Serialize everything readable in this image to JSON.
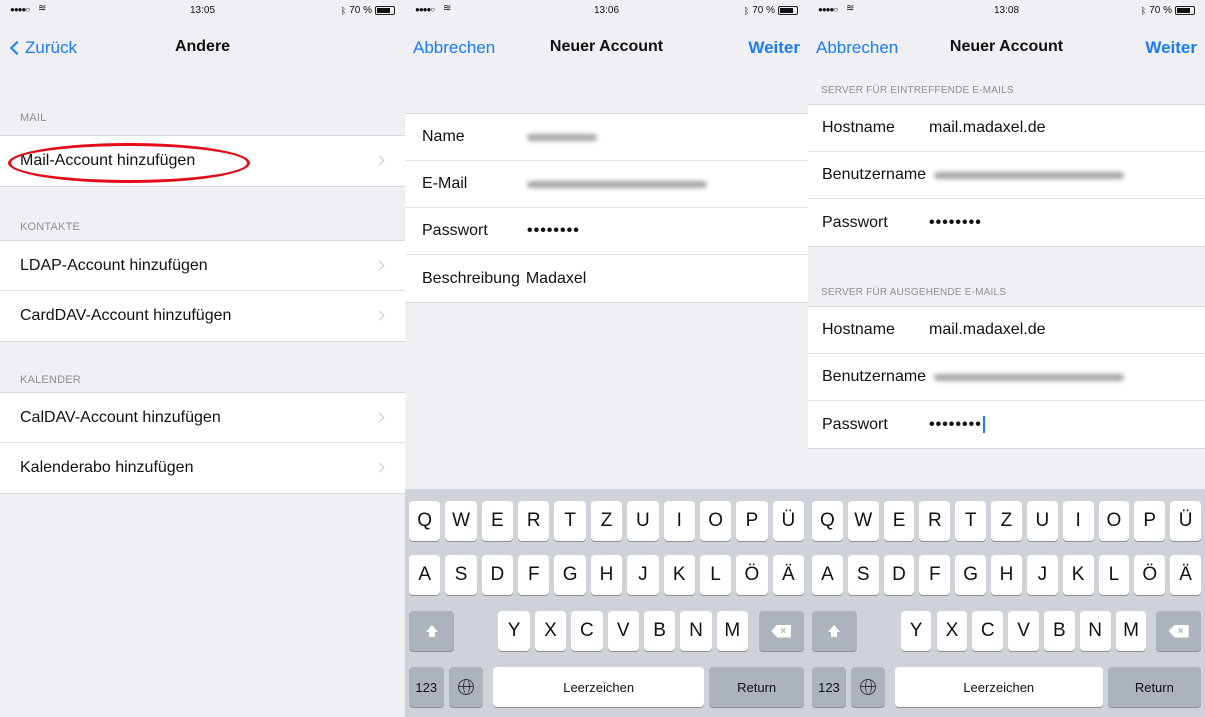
{
  "screen1": {
    "status": {
      "signal": "●●●●○",
      "time": "13:05",
      "battery": "70 %"
    },
    "nav": {
      "back": "Zurück",
      "title": "Andere"
    },
    "sections": [
      {
        "label": "MAIL",
        "items": [
          "Mail-Account hinzufügen"
        ]
      },
      {
        "label": "KONTAKTE",
        "items": [
          "LDAP-Account hinzufügen",
          "CardDAV-Account hinzufügen"
        ]
      },
      {
        "label": "KALENDER",
        "items": [
          "CalDAV-Account hinzufügen",
          "Kalenderabo hinzufügen"
        ]
      }
    ],
    "highlight_color": "#e30b17"
  },
  "screen2": {
    "status": {
      "signal": "●●●●○",
      "time": "13:06",
      "battery": "70 %"
    },
    "nav": {
      "cancel": "Abbrechen",
      "title": "Neuer Account",
      "next": "Weiter"
    },
    "fields": [
      {
        "label": "Name",
        "value": ""
      },
      {
        "label": "E-Mail",
        "value": ""
      },
      {
        "label": "Passwort",
        "value": "••••••••"
      },
      {
        "label": "Beschreibung",
        "value": "Madaxel"
      }
    ]
  },
  "screen3": {
    "status": {
      "signal": "●●●●○",
      "time": "13:08",
      "battery": "70 %"
    },
    "nav": {
      "cancel": "Abbrechen",
      "title": "Neuer Account",
      "next": "Weiter"
    },
    "incoming": {
      "label": "SERVER FÜR EINTREFFENDE E-MAILS",
      "hostname_label": "Hostname",
      "hostname": "mail.madaxel.de",
      "user_label": "Benutzername",
      "password_label": "Passwort",
      "password": "••••••••"
    },
    "outgoing": {
      "label": "SERVER FÜR AUSGEHENDE E-MAILS",
      "hostname_label": "Hostname",
      "hostname": "mail.madaxel.de",
      "user_label": "Benutzername",
      "password_label": "Passwort",
      "password": "••••••••"
    }
  },
  "keyboard": {
    "row1": [
      "Q",
      "W",
      "E",
      "R",
      "T",
      "Z",
      "U",
      "I",
      "O",
      "P",
      "Ü"
    ],
    "row2": [
      "A",
      "S",
      "D",
      "F",
      "G",
      "H",
      "J",
      "K",
      "L",
      "Ö",
      "Ä"
    ],
    "row3": [
      "Y",
      "X",
      "C",
      "V",
      "B",
      "N",
      "M"
    ],
    "numbers": "123",
    "space": "Leerzeichen",
    "return": "Return",
    "key_color": "#ffffff",
    "function_key_color": "#adb3bc",
    "background": "#cfd3d9"
  },
  "accent": "#1a7cf5"
}
